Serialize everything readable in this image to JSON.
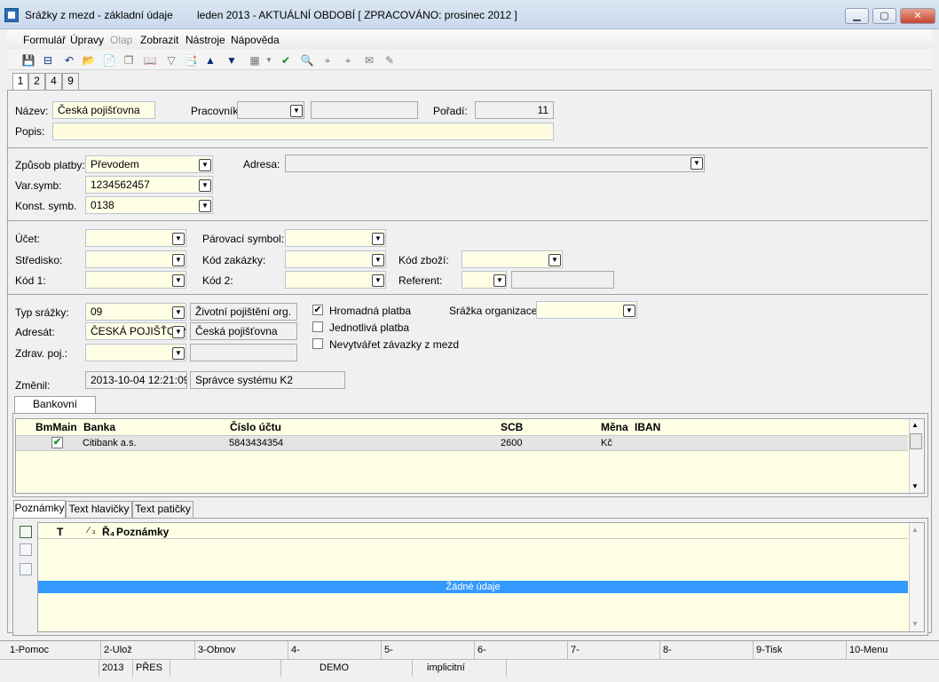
{
  "window": {
    "title": "Srážky z mezd - základní údaje",
    "period": "leden 2013 - AKTUÁLNÍ OBDOBÍ [ ZPRACOVÁNO: prosinec 2012 ]",
    "btn_min": "▁",
    "btn_max": "▢",
    "btn_close": "✕"
  },
  "menu": [
    "Formulář",
    "Úpravy",
    "Olap",
    "Zobrazit",
    "Nástroje",
    "Nápověda"
  ],
  "toolbar": {
    "icons": [
      "save-icon",
      "save-close-icon",
      "undo-icon",
      "open-folder-icon",
      "new-doc-icon",
      "copy-icon",
      "book-icon",
      "filter-icon",
      "filter-doc-icon",
      "arrow-up-icon",
      "arrow-down-icon",
      "new-record-icon",
      "excel-icon",
      "binoculars-icon",
      "find-next-icon",
      "find-replace-icon",
      "mail-icon",
      "edit-doc-icon"
    ],
    "glyphs": [
      "💾",
      "⊟",
      "↶",
      "📂",
      "📄",
      "❐",
      "📖",
      "▽",
      "📑",
      "▲",
      "▼",
      "▦",
      "✔",
      "🔍",
      "⌖",
      "⌖",
      "✉",
      "✎"
    ]
  },
  "tabs": [
    "1",
    "2",
    "4",
    "9"
  ],
  "form": {
    "nazev_label": "Název:",
    "nazev_value": "Česká pojišťovna",
    "pracovnik_label": "Pracovník:",
    "pracovnik_value": "",
    "pracovnik_name": "",
    "poradi_label": "Pořadí:",
    "poradi_value": "11",
    "popis_label": "Popis:",
    "popis_value": "",
    "zpusob_label": "Způsob platby:",
    "zpusob_value": "Převodem",
    "adresa_label": "Adresa:",
    "adresa_value": "",
    "varsymb_label": "Var.symb:",
    "varsymb_value": "1234562457",
    "konst_label": "Konst. symb.",
    "konst_value": "0138",
    "ucet_label": "Účet:",
    "ucet_value": "",
    "parovaci_label": "Párovací symbol:",
    "parovaci_value": "",
    "stredisko_label": "Středisko:",
    "stredisko_value": "",
    "kodzakazky_label": "Kód zakázky:",
    "kodzakazky_value": "",
    "kodzbozi_label": "Kód zboží:",
    "kodzbozi_value": "",
    "kod1_label": "Kód 1:",
    "kod1_value": "",
    "kod2_label": "Kód 2:",
    "kod2_value": "",
    "referent_label": "Referent:",
    "referent_value": "",
    "referent_name": "",
    "typ_label": "Typ srážky:",
    "typ_value": "09",
    "typ_name": "Životní pojištění org.",
    "adresat_label": "Adresát:",
    "adresat_value": "ČESKÁ POJIŠŤOVNA",
    "adresat_name": "Česká pojišťovna",
    "zdrav_label": "Zdrav. poj.:",
    "zdrav_value": "",
    "zdrav_name": "",
    "hromadna_label": "Hromadná platba",
    "hromadna_checked": true,
    "jednotliva_label": "Jednotlivá platba",
    "jednotliva_checked": false,
    "nevytvaret_label": "Nevytvářet závazky z mezd",
    "nevytvaret_checked": false,
    "srazka_org_label": "Srážka organizace:",
    "srazka_org_value": "",
    "zmenil_label": "Změnil:",
    "zmenil_date": "2013-10-04 12:21:09",
    "zmenil_user": "Správce systému K2"
  },
  "bank": {
    "tab": "Bankovní spojení",
    "columns": [
      "BmMain",
      "Banka",
      "Číslo účtu",
      "SCB",
      "Měna",
      "IBAN"
    ],
    "rows": [
      {
        "main": true,
        "banka": "Citibank a.s.",
        "cislo": "5843434354",
        "scb": "2600",
        "mena": "Kč",
        "iban": ""
      }
    ]
  },
  "notes": {
    "tabs": [
      "Poznámky",
      "Text hlavičky",
      "Text patičky"
    ],
    "columns": [
      "T",
      "⁄ ₃",
      "Ř₄",
      "Poznámky"
    ],
    "empty": "Žádné údaje"
  },
  "fkeys": [
    "1-Pomoc",
    "2-Ulož",
    "3-Obnov",
    "4-",
    "5-",
    "6-",
    "7-",
    "8-",
    "9-Tisk",
    "10-Menu"
  ],
  "status": [
    "",
    "2013",
    "PŘES",
    "",
    "DEMO",
    "implicitní",
    ""
  ],
  "colors": {
    "accent": "#3399ff",
    "field_bg": "#ffffe6",
    "selected_row": "#e4e4e4"
  }
}
